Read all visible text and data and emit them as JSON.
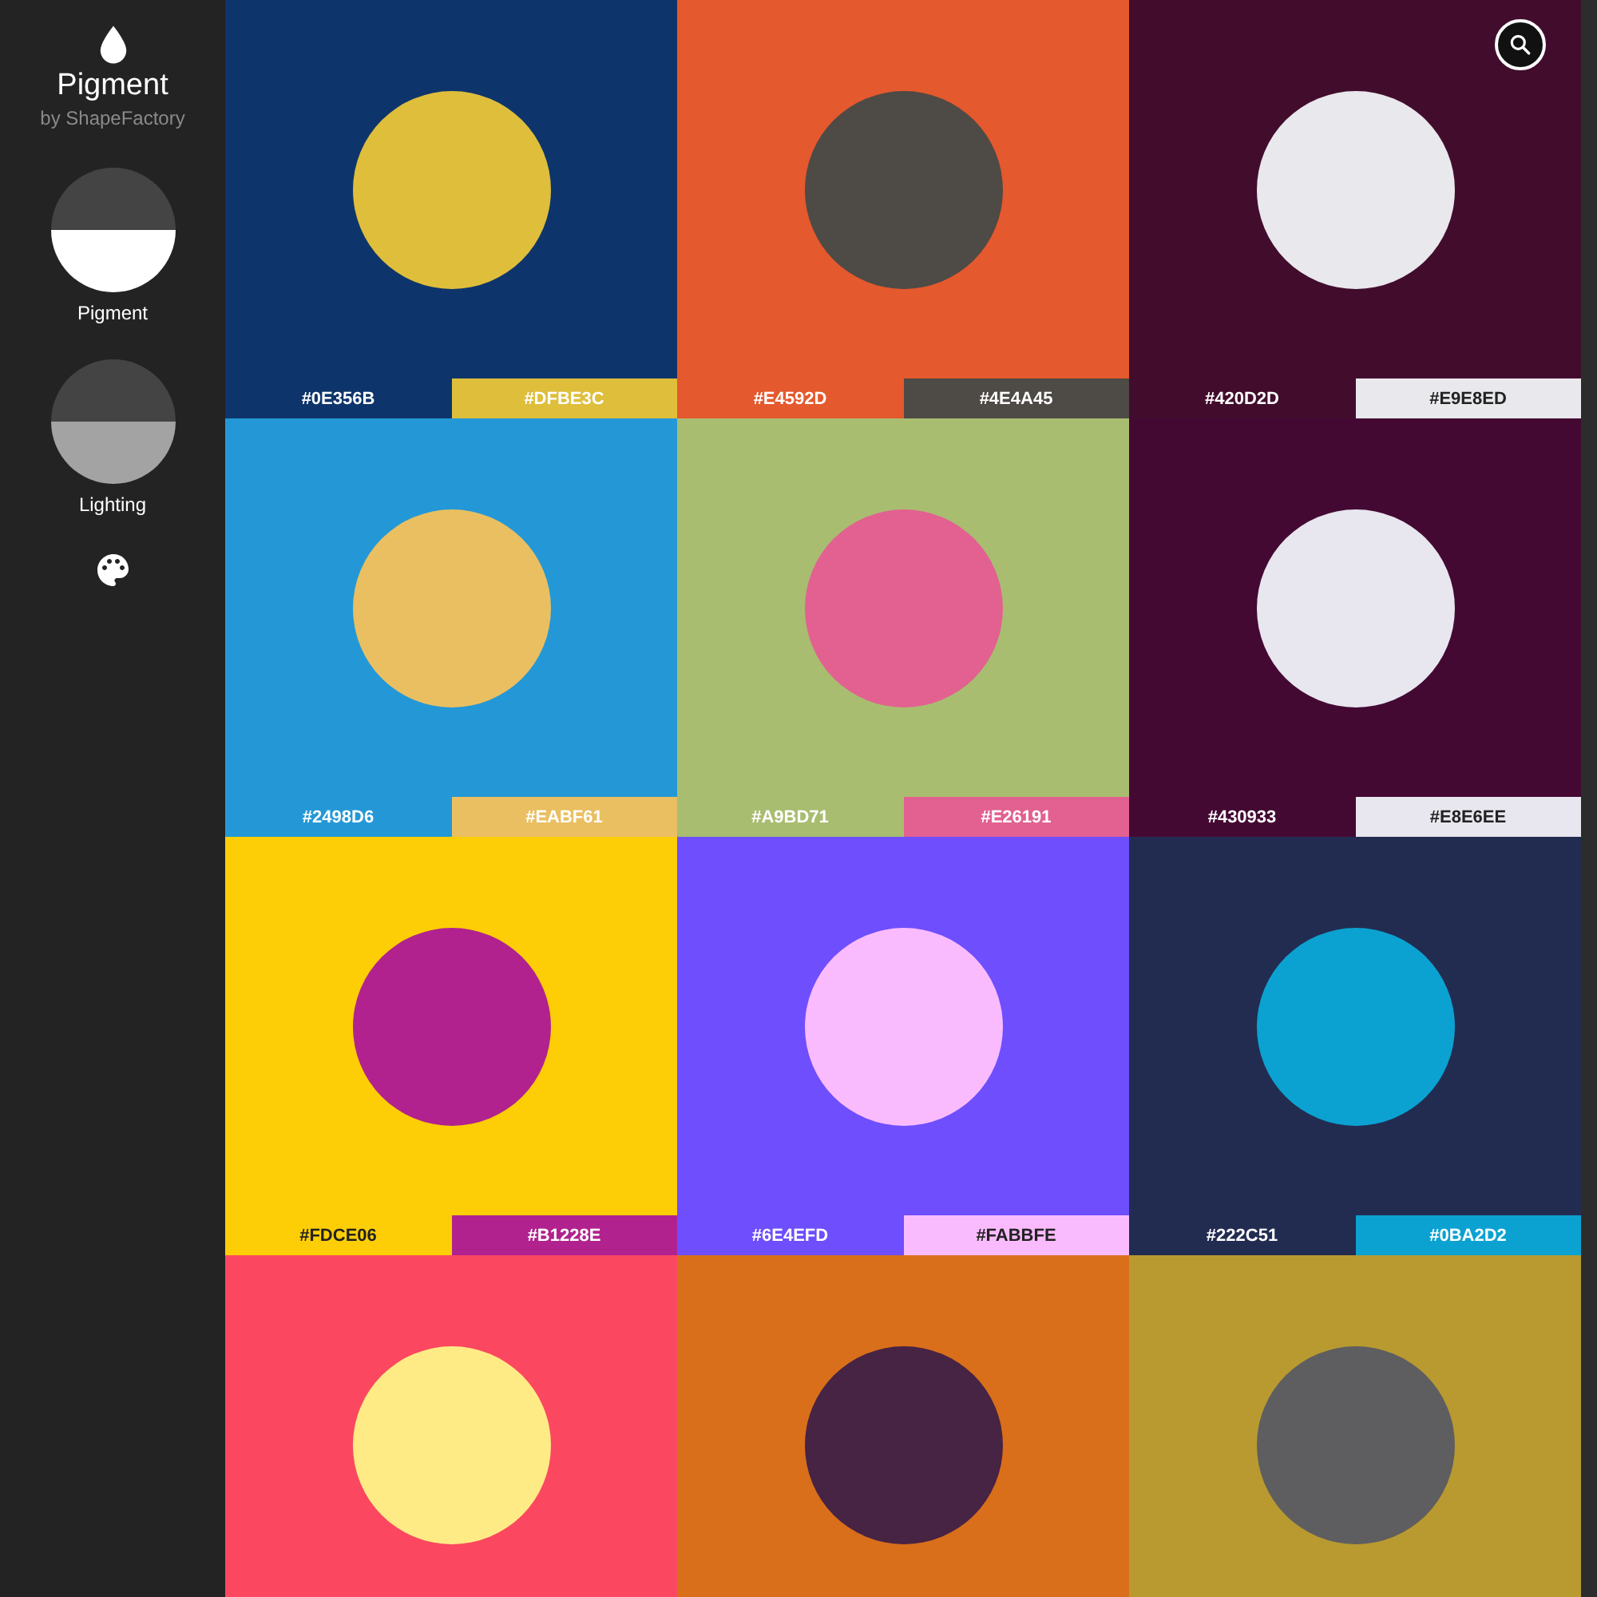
{
  "app": {
    "name": "Pigment",
    "byline": "by ShapeFactory"
  },
  "modes": [
    {
      "label": "Pigment",
      "selected": true
    },
    {
      "label": "Lighting",
      "selected": false
    }
  ],
  "palettes": [
    {
      "labels": [
        {
          "text": "#0E356B",
          "dark_text": false
        },
        {
          "text": "#DFBE3C",
          "dark_text": false
        }
      ]
    },
    {
      "labels": [
        {
          "text": "#E4592D",
          "dark_text": false
        },
        {
          "text": "#4E4A45",
          "dark_text": false
        }
      ]
    },
    {
      "labels": [
        {
          "text": "#420D2D",
          "dark_text": false
        },
        {
          "text": "#E9E8ED",
          "dark_text": true
        }
      ]
    },
    {
      "labels": [
        {
          "text": "#2498D6",
          "dark_text": false
        },
        {
          "text": "#EABF61",
          "dark_text": false
        }
      ]
    },
    {
      "labels": [
        {
          "text": "#A9BD71",
          "dark_text": false
        },
        {
          "text": "#E26191",
          "dark_text": false
        }
      ]
    },
    {
      "labels": [
        {
          "text": "#430933",
          "dark_text": false
        },
        {
          "text": "#E8E6EE",
          "dark_text": true
        }
      ]
    },
    {
      "labels": [
        {
          "text": "#FDCE06",
          "dark_text": true
        },
        {
          "text": "#B1228E",
          "dark_text": false
        }
      ]
    },
    {
      "labels": [
        {
          "text": "#6E4EFD",
          "dark_text": false
        },
        {
          "text": "#FABBFE",
          "dark_text": true
        }
      ]
    },
    {
      "labels": [
        {
          "text": "#222C51",
          "dark_text": false
        },
        {
          "text": "#0BA2D2",
          "dark_text": false
        }
      ]
    },
    {
      "swatch": {
        "color": "#fb4860"
      },
      "circle": {
        "color": "#ffeb85"
      }
    },
    {
      "swatch": {
        "color": "#d96f1a"
      },
      "circle": {
        "color": "#472344"
      }
    },
    {
      "swatch": {
        "color": "#b89a30"
      },
      "circle": {
        "color": "#5e5e60"
      }
    }
  ]
}
